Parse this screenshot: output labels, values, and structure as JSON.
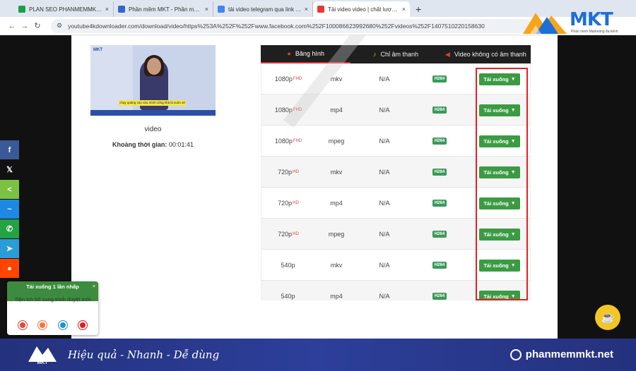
{
  "browser": {
    "tabs": [
      {
        "title": "PLAN SEO PHANMEMMKT.NET",
        "favicon_color": "#1e9e4a"
      },
      {
        "title": "Phần mềm MKT - Phần mềm M",
        "favicon_color": "#3366cc"
      },
      {
        "title": "tải video telegram qua link - Go",
        "favicon_color": "#4285f4"
      },
      {
        "title": "Tải video video | chất lượng FH",
        "favicon_color": "#e53935"
      }
    ],
    "url": "youtube4kdownloader.com/download/video/https%253A%252F%252Fwww.facebook.com%252F100086623992680%252Fvideos%252F1407510220158630"
  },
  "mkt_logo": {
    "word": "MKT",
    "tagline": "Phần mềm Marketing đa kênh"
  },
  "video": {
    "thumb_logo": "MKT",
    "thumb_caption": "chạy quảng cáo vào mình cũng khá là suôn sẻ",
    "title": "video",
    "duration_label": "Khoảng thời gian:",
    "duration_value": "00:01:41"
  },
  "tabs": [
    {
      "label": "Băng hình",
      "icon": "play-icon"
    },
    {
      "label": "Chỉ âm thanh",
      "icon": "music-icon"
    },
    {
      "label": "Video không có âm thanh",
      "icon": "mute-icon"
    }
  ],
  "rows": [
    {
      "res": "1080p",
      "tag": "FHD",
      "format": "mkv",
      "size": "N/A",
      "codec": "H264",
      "download": "Tải xuống"
    },
    {
      "res": "1080p",
      "tag": "FHD",
      "format": "mp4",
      "size": "N/A",
      "codec": "H264",
      "download": "Tải xuống"
    },
    {
      "res": "1080p",
      "tag": "FHD",
      "format": "mpeg",
      "size": "N/A",
      "codec": "H264",
      "download": "Tải xuống"
    },
    {
      "res": "720p",
      "tag": "HD",
      "format": "mkv",
      "size": "N/A",
      "codec": "H264",
      "download": "Tải xuống"
    },
    {
      "res": "720p",
      "tag": "HD",
      "format": "mp4",
      "size": "N/A",
      "codec": "H264",
      "download": "Tải xuống"
    },
    {
      "res": "720p",
      "tag": "HD",
      "format": "mpeg",
      "size": "N/A",
      "codec": "H264",
      "download": "Tải xuống"
    },
    {
      "res": "540p",
      "tag": "",
      "format": "mkv",
      "size": "N/A",
      "codec": "H264",
      "download": "Tải xuống"
    },
    {
      "res": "540p",
      "tag": "",
      "format": "mp4",
      "size": "N/A",
      "codec": "H264",
      "download": "Tải xuống"
    }
  ],
  "social": [
    {
      "name": "facebook-icon",
      "glyph": "f",
      "color": "#3b5998"
    },
    {
      "name": "x-icon",
      "glyph": "𝕏",
      "color": "#111111"
    },
    {
      "name": "share-icon",
      "glyph": "<",
      "color": "#7bc142"
    },
    {
      "name": "messenger-icon",
      "glyph": "~",
      "color": "#1e88e5"
    },
    {
      "name": "whatsapp-icon",
      "glyph": "✆",
      "color": "#25a244"
    },
    {
      "name": "telegram-icon",
      "glyph": "➤",
      "color": "#2a9dd8"
    },
    {
      "name": "reddit-icon",
      "glyph": "●",
      "color": "#ff4500"
    }
  ],
  "popup": {
    "title": "Tải xuống 1 lần nhấp",
    "subtitle": "Tiện ích bổ sung trình duyệt mới",
    "close": "×",
    "browsers": [
      {
        "name": "chrome-icon",
        "color": "#e8453c"
      },
      {
        "name": "firefox-icon",
        "color": "#ff7139"
      },
      {
        "name": "edge-icon",
        "color": "#1f8fd6"
      },
      {
        "name": "opera-icon",
        "color": "#e01b24"
      }
    ]
  },
  "banner": {
    "logo_word": "MKT",
    "slogan": "Hiệu quả - Nhanh - Dễ dùng",
    "site": "phanmemmkt.net"
  }
}
